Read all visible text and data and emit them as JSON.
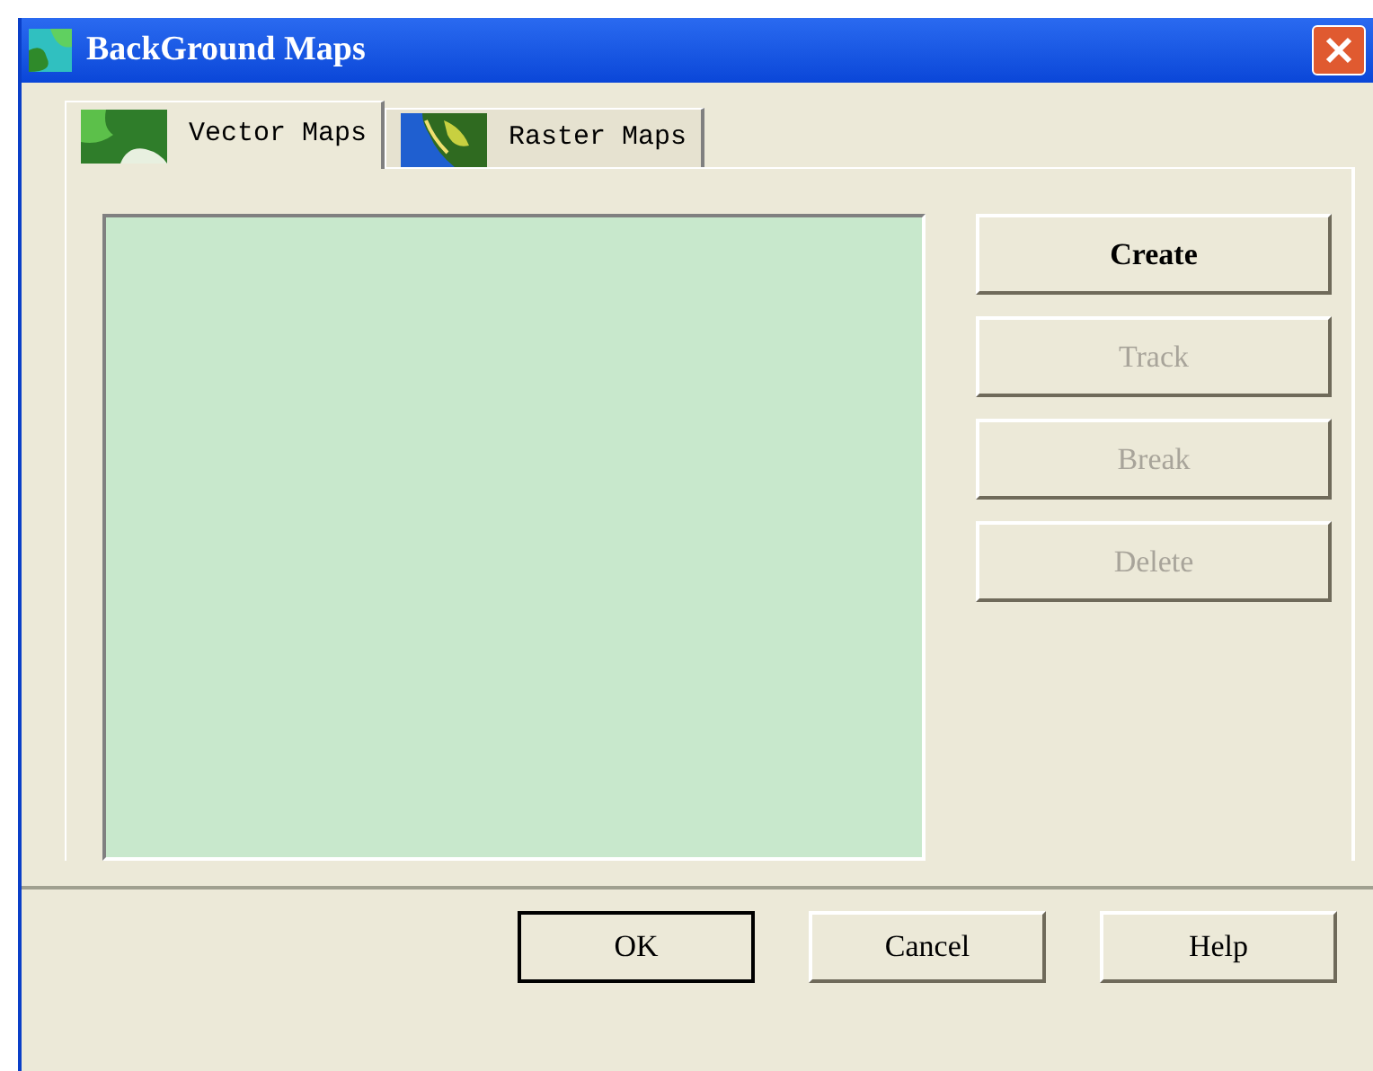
{
  "window": {
    "title": "BackGround Maps"
  },
  "tabs": [
    {
      "label": "Vector Maps",
      "selected": true,
      "kind": "vector"
    },
    {
      "label": "Raster Maps",
      "selected": false,
      "kind": "raster"
    }
  ],
  "side_buttons": [
    {
      "label": "Create",
      "disabled": false
    },
    {
      "label": "Track",
      "disabled": true
    },
    {
      "label": "Break",
      "disabled": true
    },
    {
      "label": "Delete",
      "disabled": true
    }
  ],
  "footer_buttons": [
    {
      "label": "OK",
      "default": true
    },
    {
      "label": "Cancel",
      "default": false
    },
    {
      "label": "Help",
      "default": false
    }
  ]
}
